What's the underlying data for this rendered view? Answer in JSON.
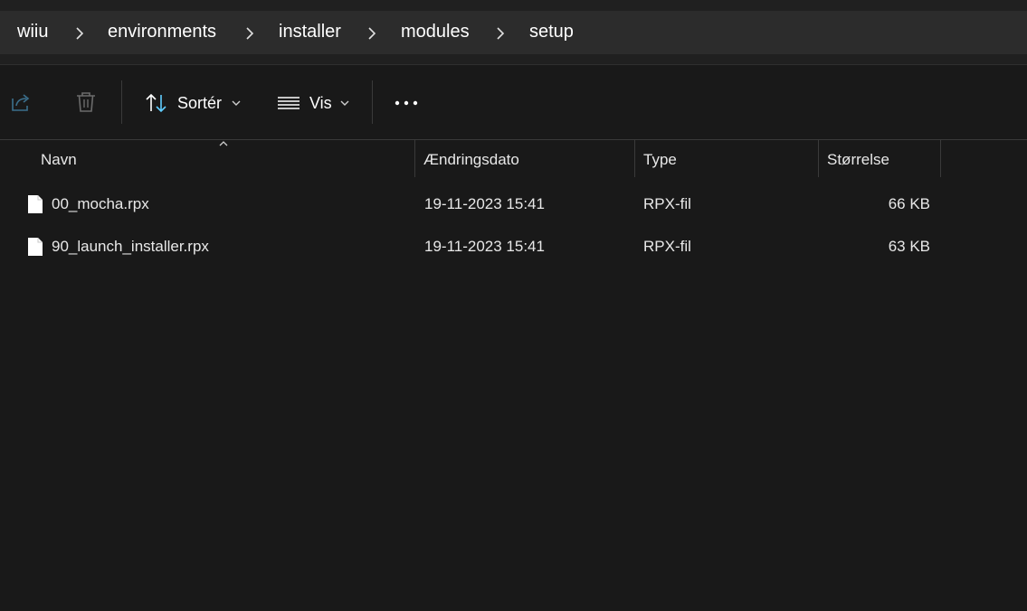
{
  "breadcrumb": {
    "items": [
      "wiiu",
      "environments",
      "installer",
      "modules",
      "setup"
    ]
  },
  "toolbar": {
    "sort_label": "Sortér",
    "view_label": "Vis",
    "icons": {
      "share": "share-icon",
      "delete": "trash-icon",
      "sort": "sort-arrows-icon",
      "view": "list-view-icon",
      "more": "more-options-icon"
    }
  },
  "columns": {
    "name": "Navn",
    "date": "Ændringsdato",
    "type": "Type",
    "size": "Størrelse"
  },
  "files": [
    {
      "name": "00_mocha.rpx",
      "date": "19-11-2023 15:41",
      "type": "RPX-fil",
      "size": "66 KB"
    },
    {
      "name": "90_launch_installer.rpx",
      "date": "19-11-2023 15:41",
      "type": "RPX-fil",
      "size": "63 KB"
    }
  ],
  "colors": {
    "background": "#191919",
    "address_bar": "#2c2c2c",
    "accent": "#60cdff"
  }
}
